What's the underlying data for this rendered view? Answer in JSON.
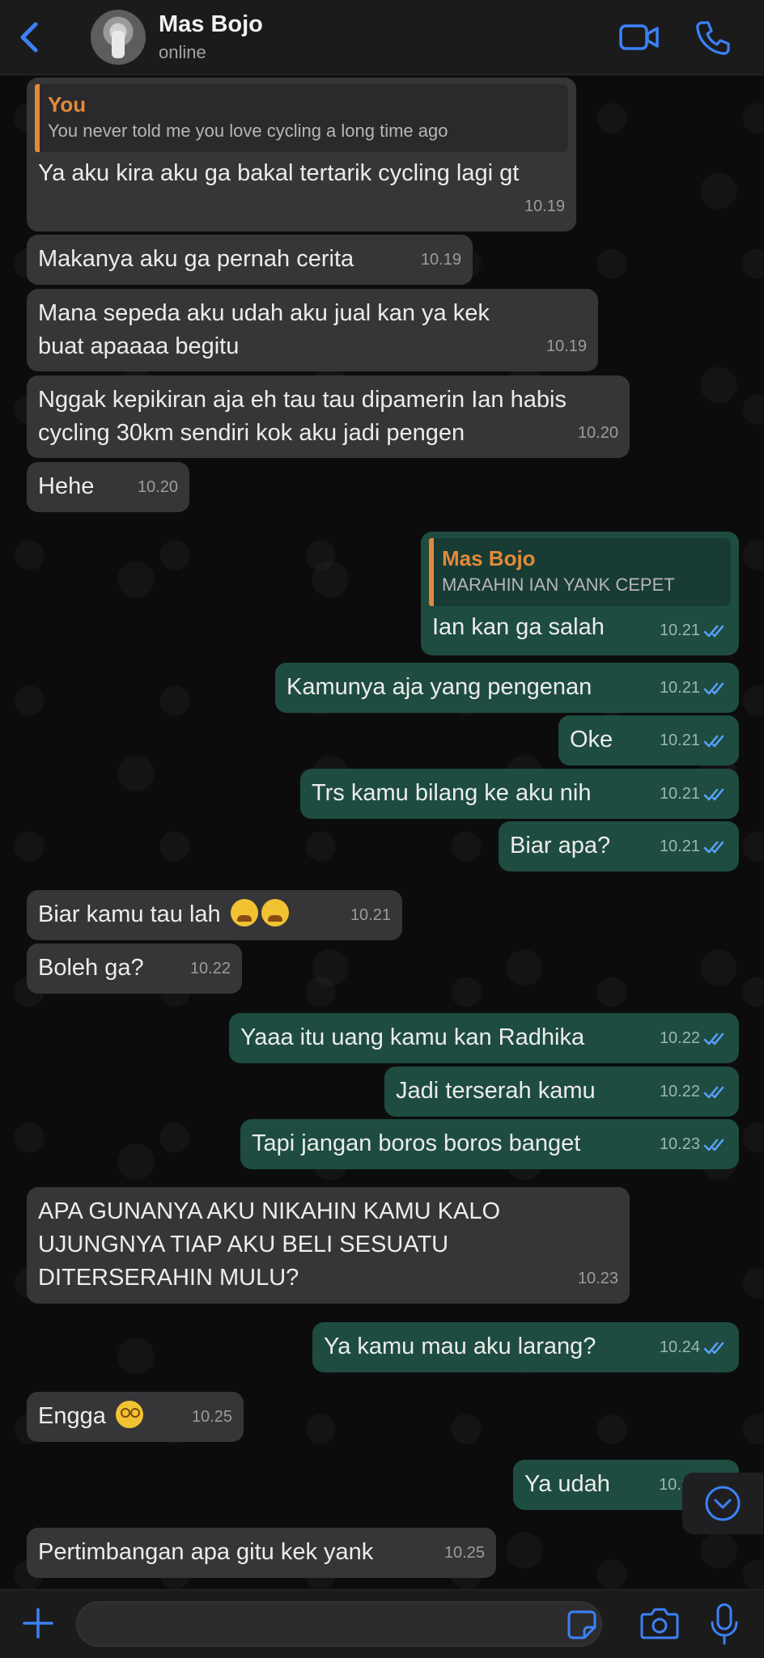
{
  "header": {
    "contact_name": "Mas Bojo",
    "status": "online"
  },
  "colors": {
    "accent": "#3b82f6",
    "incoming_bubble": "#363638",
    "outgoing_bubble": "#1e4c40",
    "quote_author": "#e28a3a",
    "read_ticks": "#5aa0ff"
  },
  "messages": [
    {
      "dir": "in",
      "quote_author": "You",
      "quote_text": "You never told me you love cycling a long time ago",
      "text": "Ya aku kira aku ga bakal tertarik cycling lagi gt",
      "time": "10.19"
    },
    {
      "dir": "in",
      "text": "Makanya aku ga pernah cerita",
      "time": "10.19"
    },
    {
      "dir": "in",
      "text": "Mana sepeda aku udah aku jual kan ya kek buat apaaaa begitu",
      "time": "10.19"
    },
    {
      "dir": "in",
      "text": "Nggak kepikiran aja eh tau tau dipamerin Ian habis cycling 30km sendiri kok aku jadi pengen",
      "time": "10.20"
    },
    {
      "dir": "in",
      "text": "Hehe",
      "time": "10.20"
    },
    {
      "dir": "out",
      "quote_author": "Mas Bojo",
      "quote_text": "MARAHIN IAN YANK CEPET",
      "text": "Ian kan ga salah",
      "time": "10.21"
    },
    {
      "dir": "out",
      "text": "Kamunya aja yang pengenan",
      "time": "10.21"
    },
    {
      "dir": "out",
      "text": "Oke",
      "time": "10.21"
    },
    {
      "dir": "out",
      "text": "Trs kamu bilang ke aku nih",
      "time": "10.21"
    },
    {
      "dir": "out",
      "text": "Biar apa?",
      "time": "10.21"
    },
    {
      "dir": "in",
      "text": "Biar kamu tau lah",
      "emoji": "tired-face-icon x2",
      "time": "10.21"
    },
    {
      "dir": "in",
      "text": "Boleh ga?",
      "time": "10.22"
    },
    {
      "dir": "out",
      "text": "Yaaa itu uang kamu kan Radhika",
      "time": "10.22"
    },
    {
      "dir": "out",
      "text": "Jadi terserah kamu",
      "time": "10.22"
    },
    {
      "dir": "out",
      "text": "Tapi jangan boros boros banget",
      "time": "10.23"
    },
    {
      "dir": "in",
      "text": "APA GUNANYA AKU NIKAHIN KAMU KALO UJUNGNYA TIAP AKU BELI SESUATU DITERSERAHIN MULU?",
      "time": "10.23"
    },
    {
      "dir": "out",
      "text": "Ya kamu mau aku larang?",
      "time": "10.24"
    },
    {
      "dir": "in",
      "text": "Engga",
      "emoji": "dizzy-face-icon",
      "time": "10.25"
    },
    {
      "dir": "out",
      "text": "Ya udah",
      "time": "10.2"
    },
    {
      "dir": "in",
      "text": "Pertimbangan apa gitu kek yank",
      "time": "10.25"
    }
  ],
  "icons": {
    "back": "chevron-left-icon",
    "video": "video-camera-icon",
    "call": "phone-icon",
    "scroll": "chevron-down-circle-icon",
    "plus": "plus-icon",
    "sticker": "sticker-icon",
    "camera": "camera-icon",
    "mic": "microphone-icon"
  }
}
